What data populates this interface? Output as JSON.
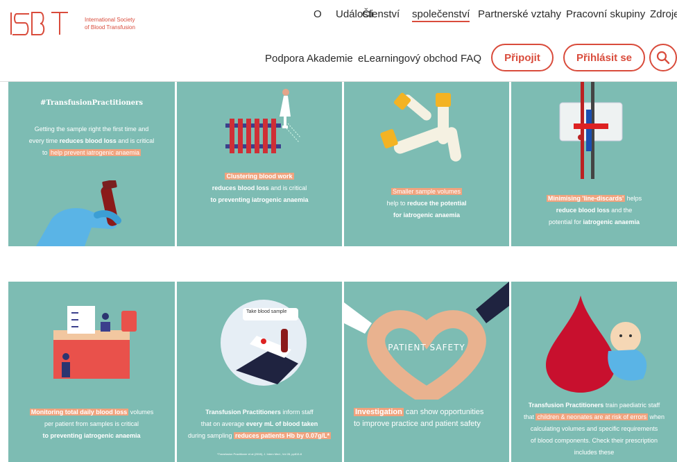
{
  "logo": {
    "letters": "ISBT",
    "line1": "International Society",
    "line2": "of Blood Transfusion",
    "brand_color": "#d94b3b"
  },
  "nav_top": [
    "O",
    "Události",
    "Členství",
    "společenství",
    "Partnerské vztahy",
    "Pracovní skupiny",
    "Zdroje"
  ],
  "nav_bottom": [
    "Podpora Akademie",
    "eLearningový obchod",
    "FAQ"
  ],
  "buttons": {
    "join": "Připojit",
    "login": "Přihlásit se"
  },
  "tiles": {
    "t1": {
      "title": "#TransfusionPractitioners",
      "p1": "Getting the sample right the first time and",
      "p2a": "every time ",
      "p2b": "reduces blood loss",
      "p2c": " and is critical",
      "p3a": "to ",
      "p3b": "help prevent iatrogenic anaemia"
    },
    "t2": {
      "hl": "Clustering blood work",
      "l2a": "reduces blood loss",
      "l2b": " and is critical",
      "l3": "to preventing iatrogenic anaemia"
    },
    "t3": {
      "hl": "Smaller sample volumes",
      "l2a": "help to ",
      "l2b": "reduce the potential",
      "l3": "for iatrogenic anaemia"
    },
    "t4": {
      "hl": "Minimising 'line-discards'",
      "l1b": " helps",
      "l2a": "reduce blood loss",
      "l2b": " and the",
      "l3a": "potential for ",
      "l3b": "iatrogenic anaemia"
    },
    "t5": {
      "hl": "Monitoring total daily blood loss",
      "l1b": " volumes",
      "l2": "per patient from samples is critical",
      "l3": "to preventing iatrogenic anaemia"
    },
    "t6": {
      "bubble": "Take blood sample",
      "l1a": "Transfusion Practitioners",
      "l1b": " inform staff",
      "l2a": "that on average ",
      "l2b": "every mL of blood taken",
      "l3a": "during sampling ",
      "l3b": "reduces patients Hb by 0.07g/L*",
      "foot": "*Transfusion Practitioner et al (2008), J. Intern Med., Vol 28, pp813-8"
    },
    "t7": {
      "heart": "PATIENT SAFETY",
      "hl": "Investigation",
      "l1b": " can show opportunities",
      "l2": "to improve practice and patient safety"
    },
    "t8": {
      "l1a": "Transfusion Practitioners",
      "l1b": " train paediatric staff",
      "l2a": "that ",
      "l2b": "children & neonates are at risk of errors",
      "l2c": " when",
      "l3": "calculating volumes and specific requirements",
      "l4": "of blood components. Check their prescription",
      "l5": "includes these"
    }
  },
  "colors": {
    "tile_bg": "#7dbcb3",
    "highlight": "#f0a37e",
    "accent": "#d94b3b"
  }
}
